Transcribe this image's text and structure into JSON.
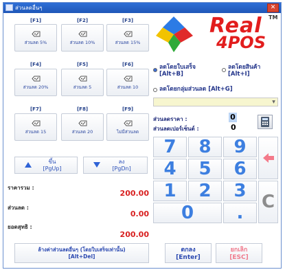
{
  "window": {
    "title": "ส่วนลดอื่นๆ",
    "close_glyph": "✕"
  },
  "discount_buttons": [
    {
      "key": "[F1]",
      "label": "ส่วนลด 5%"
    },
    {
      "key": "[F2]",
      "label": "ส่วนลด 10%"
    },
    {
      "key": "[F3]",
      "label": "ส่วนลด 15%"
    },
    {
      "key": "[F4]",
      "label": "ส่วนลด 20%"
    },
    {
      "key": "[F5]",
      "label": "ส่วนลด 5"
    },
    {
      "key": "[F6]",
      "label": "ส่วนลด 10"
    },
    {
      "key": "[F7]",
      "label": "ส่วนลด 15"
    },
    {
      "key": "[F8]",
      "label": "ส่วนลด 20"
    },
    {
      "key": "[F9]",
      "label": "ไม่มีส่วนลด"
    }
  ],
  "nav": {
    "up_line1": "ขึ้น",
    "up_line2": "[PgUp]",
    "down_line1": "ลง",
    "down_line2": "[PgDn]"
  },
  "summary": {
    "total_label": "ราคารวม :",
    "total_value": "200.00",
    "discount_label": "ส่วนลด :",
    "discount_value": "0.00",
    "net_label": "ยอดสุทธิ :",
    "net_value": "200.00"
  },
  "clear_button": {
    "line1": "ล้างค่าส่วนลดอื่นๆ (โดยใบเสร็จเท่านั้น)",
    "line2": "[Alt+Del]"
  },
  "logo": {
    "word1": "Real",
    "word2": "4POS",
    "tm": "TM"
  },
  "options": {
    "by_receipt_line1": "ลดโดยใบเสร็จ",
    "by_receipt_line2": "[Alt+B]",
    "by_item_line1": "ลดโดยสินค้า",
    "by_item_line2": "[Alt+I]",
    "by_group": "ลดโดยกลุ่มส่วนลด [Alt+G]",
    "selected": "by_receipt"
  },
  "group_combo": {
    "value": "",
    "arrow": "▼"
  },
  "fields": {
    "price_discount_label": "ส่วนลดราคา :",
    "price_discount_value": "0",
    "percent_discount_label": "ส่วนลดเปอร์เซ็นต์ :",
    "percent_discount_value": "0"
  },
  "keypad": {
    "k7": "7",
    "k8": "8",
    "k9": "9",
    "k4": "4",
    "k5": "5",
    "k6": "6",
    "k1": "1",
    "k2": "2",
    "k3": "3",
    "k0": "0",
    "dot": ".",
    "clear": "C"
  },
  "actions": {
    "ok_line1": "ตกลง",
    "ok_line2": "[Enter]",
    "cancel_line1": "ยกเลิก",
    "cancel_line2": "[ESC]"
  },
  "colors": {
    "accent_blue": "#3d7fe0",
    "value_red": "#d82020",
    "label_navy": "#1e2a7a"
  }
}
